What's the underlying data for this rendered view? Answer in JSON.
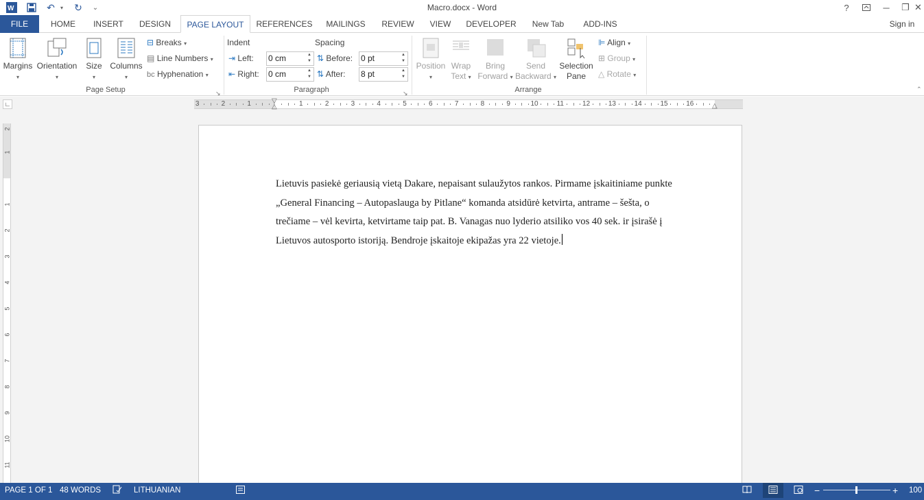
{
  "window": {
    "title": "Macro.docx - Word",
    "help": "?",
    "minimize": "─",
    "restore": "❐",
    "close": "✕"
  },
  "quick_access": {
    "undo": "↶",
    "redo": "↻",
    "more": "⌄"
  },
  "tabs": [
    "FILE",
    "HOME",
    "INSERT",
    "DESIGN",
    "PAGE LAYOUT",
    "REFERENCES",
    "MAILINGS",
    "REVIEW",
    "VIEW",
    "DEVELOPER",
    "New Tab",
    "ADD-INS"
  ],
  "active_tab": "PAGE LAYOUT",
  "sign_in": "Sign in",
  "ribbon": {
    "page_setup": {
      "label": "Page Setup",
      "margins": "Margins",
      "orientation": "Orientation",
      "size": "Size",
      "columns": "Columns",
      "breaks": "Breaks",
      "line_numbers": "Line Numbers",
      "hyphenation": "Hyphenation"
    },
    "paragraph": {
      "label": "Paragraph",
      "indent_title": "Indent",
      "spacing_title": "Spacing",
      "left_label": "Left:",
      "left_value": "0 cm",
      "right_label": "Right:",
      "right_value": "0 cm",
      "before_label": "Before:",
      "before_value": "0 pt",
      "after_label": "After:",
      "after_value": "8 pt"
    },
    "arrange": {
      "label": "Arrange",
      "position": "Position",
      "wrap_text_1": "Wrap",
      "wrap_text_2": "Text",
      "bring_forward_1": "Bring",
      "bring_forward_2": "Forward",
      "send_backward_1": "Send",
      "send_backward_2": "Backward",
      "selection_pane_1": "Selection",
      "selection_pane_2": "Pane",
      "align": "Align",
      "group": "Group",
      "rotate": "Rotate"
    }
  },
  "ruler": {
    "left_numbers": [
      "3",
      "2",
      "1"
    ],
    "right_numbers": [
      "1",
      "2",
      "3",
      "4",
      "5",
      "6",
      "7",
      "8",
      "9",
      "10",
      "11",
      "12",
      "13",
      "14",
      "15",
      "16"
    ],
    "vertical_numbers": [
      "2",
      "1",
      "1",
      "2",
      "3",
      "4",
      "5",
      "6",
      "7",
      "8",
      "9",
      "10",
      "11"
    ]
  },
  "document": {
    "lines": [
      "Lietuvis pasiekė geriausią vietą Dakare, nepaisant sulaužytos rankos. Pirmame įskaitiniame punkte",
      "„General Financing – Autopaslauga by Pitlane“ komanda atsidūrė ketvirta, antrame – šešta, o",
      "trečiame – vėl kevirta, ketvirtame taip pat. B. Vanagas nuo lyderio atsiliko vos 40 sek. ir įsirašė į",
      "Lietuvos autosporto istoriją. Bendroje įskaitoje ekipažas yra 22 vietoje."
    ]
  },
  "status": {
    "page": "PAGE 1 OF 1",
    "words": "48 WORDS",
    "language": "LITHUANIAN",
    "zoom": "100"
  }
}
